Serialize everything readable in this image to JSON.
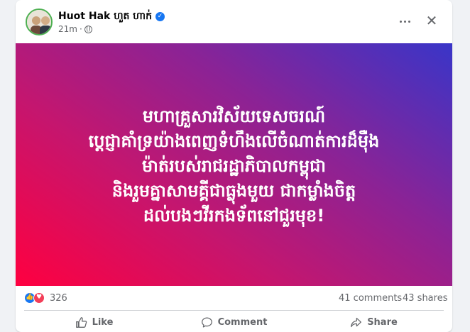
{
  "post": {
    "author": "Huot Hak ហួត ហាក់",
    "verified_mark": "✓",
    "time": "21m",
    "separator": "·",
    "audience_icon": "globe-icon",
    "more_icon": "more-horizontal-icon",
    "close_label": "✕",
    "image_text_lines": [
      "មហាគ្រួសារវិស័យទេសចរណ៍",
      "ប្ដេជ្ញាគាំទ្រយ៉ាងពេញទំហឹងលើចំណាត់ការដ៏ម៉ឺង",
      "ម៉ាត់របស់រាជរដ្ឋាភិបាលកម្ពុជា",
      "និងរួមគ្នាសាមគ្គីជាធ្លុងមួយ ជាកម្លាំងចិត្ត",
      "ដល់បងៗវីរកងទ័ពនៅជួរមុខ!"
    ]
  },
  "stats": {
    "reaction_icons": [
      "like-reaction-icon",
      "love-reaction-icon"
    ],
    "like_glyph": "👍",
    "love_glyph": "♥",
    "reaction_count": "326",
    "comments": "41 comments",
    "shares": "43 shares"
  },
  "actions": {
    "like_label": "Like",
    "comment_label": "Comment",
    "share_label": "Share"
  },
  "colors": {
    "brand_blue": "#1877f2",
    "love_red": "#f33e58",
    "gradient": [
      "#ff0040",
      "#c4166f",
      "#8a2396",
      "#3935c8"
    ]
  }
}
